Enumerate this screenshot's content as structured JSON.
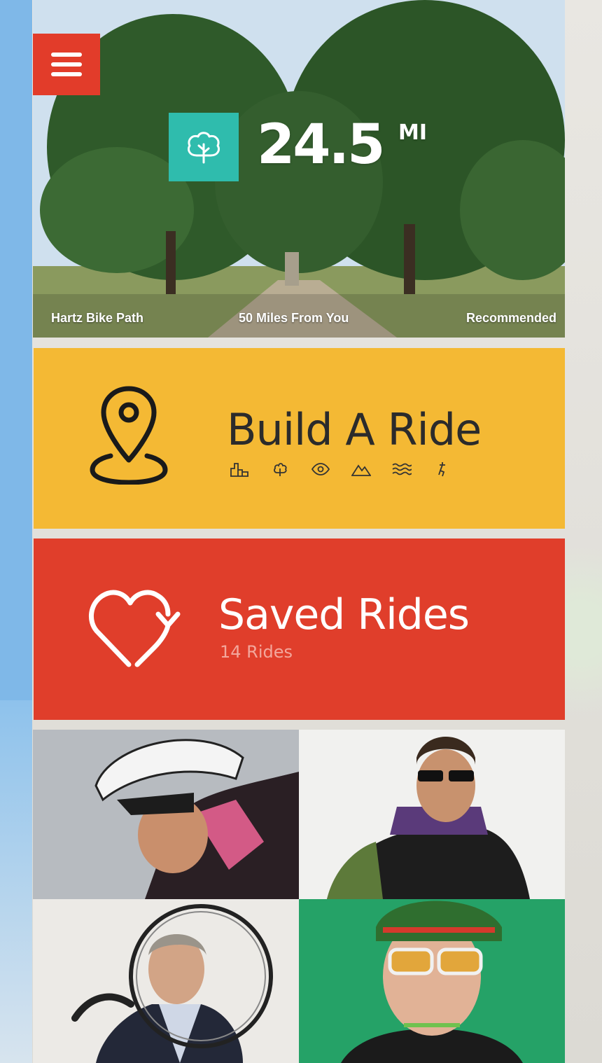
{
  "hero": {
    "distance_value": "24.5",
    "distance_unit": "MI",
    "path_name": "Hartz Bike Path",
    "distance_from_you": "50 Miles From You",
    "tag": "Recommended",
    "badge_icon": "tree-icon"
  },
  "menu": {
    "icon": "hamburger-menu-icon"
  },
  "build_ride": {
    "title": "Build A Ride",
    "icon": "location-pin-icon",
    "feature_icons": [
      "city-icon",
      "tree-icon",
      "eye-icon",
      "mountain-icon",
      "water-waves-icon",
      "bike-icon"
    ]
  },
  "saved_rides": {
    "title": "Saved Rides",
    "count_label": "14 Rides",
    "icon": "heart-refresh-icon"
  },
  "riders": [
    {
      "name": "rider-photo-1"
    },
    {
      "name": "rider-photo-2"
    },
    {
      "name": "rider-photo-3"
    },
    {
      "name": "rider-photo-4"
    }
  ],
  "colors": {
    "menu_red": "#e23c2a",
    "badge_teal": "#2fbcad",
    "build_yellow": "#f4b934",
    "saved_red": "#e03e2b"
  }
}
